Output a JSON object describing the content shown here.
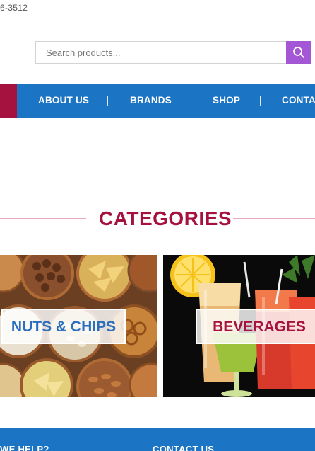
{
  "header": {
    "phone": "6-3512"
  },
  "search": {
    "placeholder": "Search products...",
    "button_icon": "search-icon"
  },
  "nav": {
    "items": [
      {
        "label": "ABOUT US"
      },
      {
        "label": "BRANDS"
      },
      {
        "label": "SHOP"
      },
      {
        "label": "CONTA"
      }
    ]
  },
  "categories": {
    "title": "CATEGORIES",
    "tiles": [
      {
        "label": "NUTS & CHIPS"
      },
      {
        "label": "BEVERAGES"
      }
    ]
  },
  "footer": {
    "left_heading": "WE HELP?",
    "right_heading": "CONTACT US"
  },
  "colors": {
    "brand_blue": "#1c74c4",
    "brand_crimson": "#a5123f",
    "search_button": "#a457d4"
  }
}
